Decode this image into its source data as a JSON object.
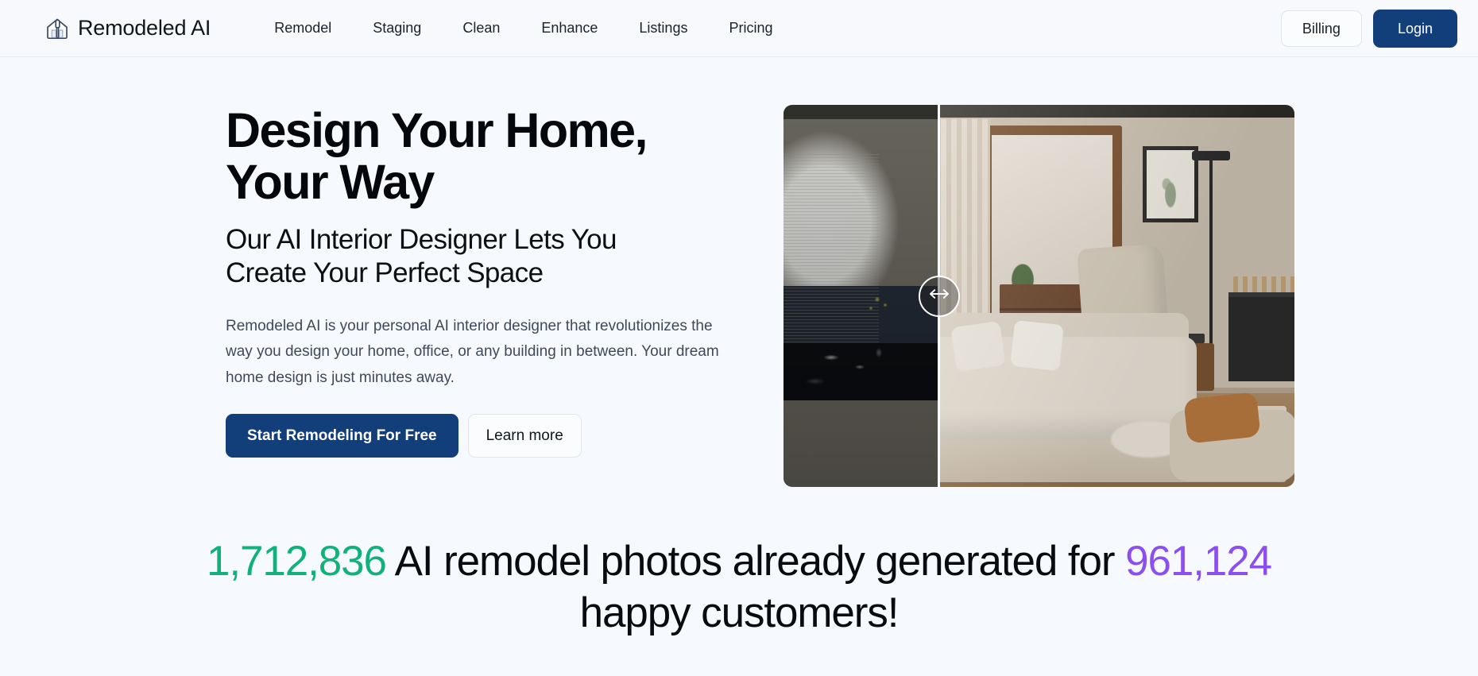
{
  "header": {
    "brand": {
      "name": "Remodeled AI",
      "icon": "house-paintbrush-icon"
    },
    "nav": [
      {
        "label": "Remodel"
      },
      {
        "label": "Staging"
      },
      {
        "label": "Clean"
      },
      {
        "label": "Enhance"
      },
      {
        "label": "Listings"
      },
      {
        "label": "Pricing"
      }
    ],
    "billing_label": "Billing",
    "login_label": "Login"
  },
  "hero": {
    "title_line1": "Design Your Home,",
    "title_line2": "Your Way",
    "subtitle_line1": "Our AI Interior Designer Lets You",
    "subtitle_line2": "Create Your Perfect Space",
    "description": "Remodeled AI is your personal AI interior designer that revolutionizes the way you design your home, office, or any building in between. Your dream home design is just minutes away.",
    "primary_button": "Start Remodeling For Free",
    "secondary_button": "Learn more",
    "comparison": {
      "handle_icon": "left-right-arrows-icon",
      "before_label": "before-room-cluttered-dark",
      "after_label": "after-room-styled-bright",
      "divider_position_percent": 30
    }
  },
  "stats": {
    "photos_count": "1,712,836",
    "photos_text": " AI remodel photos already generated",
    "for_text": "for ",
    "customers_count": "961,124",
    "customers_text": " happy customers!"
  },
  "colors": {
    "page_background": "#f6f9fd",
    "primary_navy": "#123e79",
    "stat_green": "#12b07a",
    "stat_purple": "#8b4ff0",
    "text_dark": "#05070a",
    "text_muted": "#3f4a59"
  }
}
